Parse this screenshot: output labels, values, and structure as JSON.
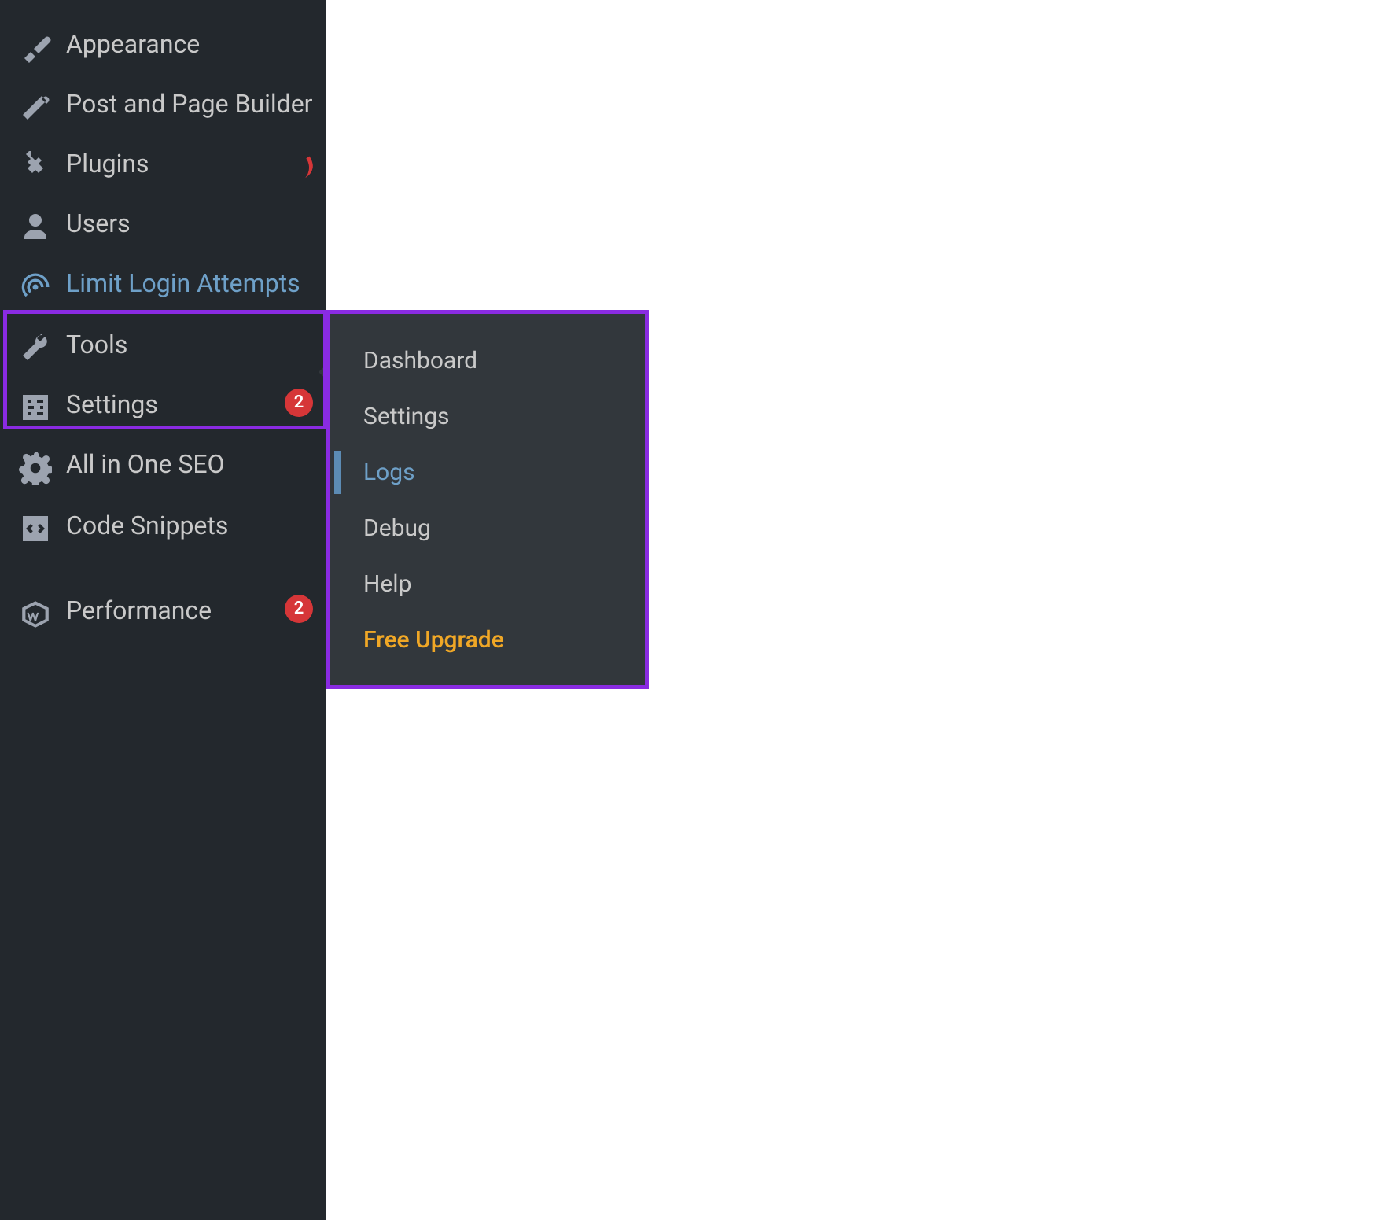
{
  "sidebar": {
    "items": [
      {
        "id": "appearance",
        "label": "Appearance",
        "icon": "brush-icon"
      },
      {
        "id": "post-page-builder",
        "label": "Post and Page Builder",
        "icon": "pencil-icon"
      },
      {
        "id": "plugins",
        "label": "Plugins",
        "icon": "plug-icon"
      },
      {
        "id": "users",
        "label": "Users",
        "icon": "user-icon"
      },
      {
        "id": "limit-login",
        "label": "Limit Login Attempts",
        "icon": "fingerprint-icon",
        "active": true
      },
      {
        "id": "tools",
        "label": "Tools",
        "icon": "wrench-icon"
      },
      {
        "id": "settings",
        "label": "Settings",
        "icon": "sliders-icon",
        "badge": "2"
      },
      {
        "id": "aioseo",
        "label": "All in One SEO",
        "icon": "gear-icon"
      },
      {
        "id": "code-snippets",
        "label": "Code Snippets",
        "icon": "code-icon"
      },
      {
        "id": "performance",
        "label": "Performance",
        "icon": "w3-cube-icon",
        "badge": "2"
      }
    ]
  },
  "submenu": {
    "parent": "limit-login",
    "items": [
      {
        "id": "dashboard",
        "label": "Dashboard"
      },
      {
        "id": "settings",
        "label": "Settings"
      },
      {
        "id": "logs",
        "label": "Logs",
        "active": true
      },
      {
        "id": "debug",
        "label": "Debug"
      },
      {
        "id": "help",
        "label": "Help"
      },
      {
        "id": "free-upgrade",
        "label": "Free Upgrade",
        "highlight": true
      }
    ]
  }
}
